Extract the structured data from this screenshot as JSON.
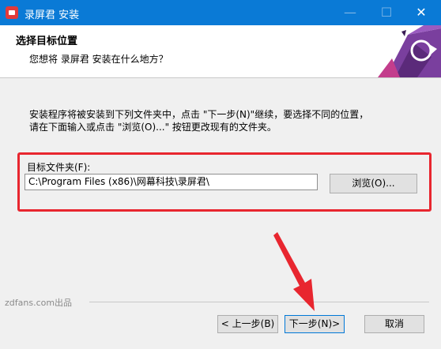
{
  "window": {
    "title": "录屏君 安装",
    "minimize_glyph": "—",
    "maximize_glyph": "☐",
    "close_glyph": "✕"
  },
  "header": {
    "title": "选择目标位置",
    "subtitle": "您想将 录屏君 安装在什么地方？"
  },
  "content": {
    "description_line1": "安装程序将被安装到下列文件夹中，点击 \"下一步(N)\"继续，要选择不同的位置，",
    "description_line2": "请在下面输入或点击 \"浏览(O)...\" 按钮更改现有的文件夹。",
    "folder_label": "目标文件夹(F):",
    "folder_path": "C:\\Program Files (x86)\\网幕科技\\录屏君\\",
    "browse_button": "浏览(O)..."
  },
  "footer": {
    "brand": "zdfans.com出品",
    "back_button": "< 上一步(B)",
    "next_button": "下一步(N)>",
    "cancel_button": "取消"
  },
  "colors": {
    "titlebar": "#0a7ad6",
    "highlight_box": "#e8262f",
    "arrow": "#e8262f",
    "logo_purple": "#5b2a7a"
  },
  "icons": [
    "app-icon",
    "minimize-icon",
    "maximize-icon",
    "close-icon",
    "logo-graphic",
    "annotation-arrow"
  ]
}
